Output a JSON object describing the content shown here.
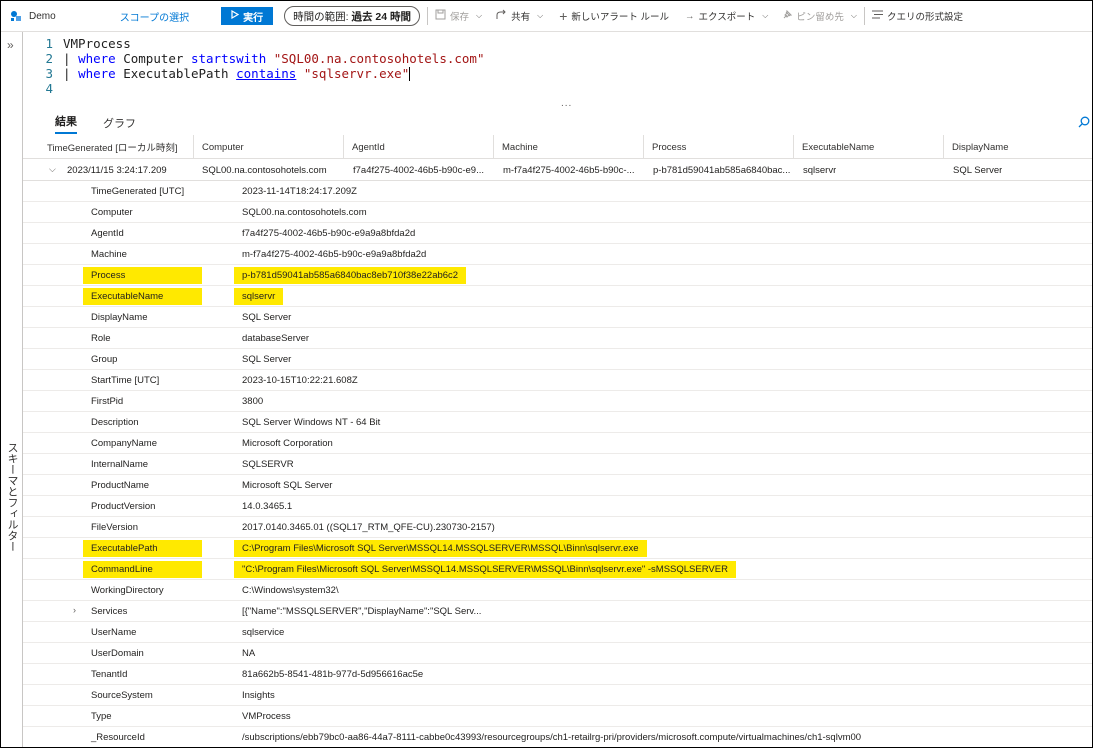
{
  "toolbar": {
    "workspace": "Demo",
    "scope_link": "スコープの選択",
    "run_label": "実行",
    "time_range_label": "時間の範囲:",
    "time_range_value": "過去 24 時間",
    "save_label": "保存",
    "share_label": "共有",
    "new_alert_label": "新しいアラート ルール",
    "export_label": "エクスポート",
    "pin_label": "ピン留め先",
    "format_label": "クエリの形式設定"
  },
  "sidebar": {
    "label": "スキーマとフィルター"
  },
  "editor": {
    "lines": [
      {
        "num": "1",
        "table": "VMProcess"
      },
      {
        "num": "2",
        "pipe": "| ",
        "kw": "where",
        "field": " Computer ",
        "op": "startswith",
        "str": " \"SQL00.na.contosohotels.com\""
      },
      {
        "num": "3",
        "pipe": "| ",
        "kw": "where",
        "field": " ExecutablePath ",
        "op": "contains",
        "str": " \"sqlservr.exe\""
      },
      {
        "num": "4"
      }
    ],
    "splitter": "..."
  },
  "tabs": [
    {
      "label": "結果",
      "active": true
    },
    {
      "label": "グラフ",
      "active": false
    }
  ],
  "grid": {
    "columns": [
      "TimeGenerated [ローカル時刻]",
      "Computer",
      "AgentId",
      "Machine",
      "Process",
      "ExecutableName",
      "DisplayName"
    ],
    "row": [
      "2023/11/15 3:24:17.209",
      "SQL00.na.contosohotels.com",
      "f7a4f275-4002-46b5-b90c-e9...",
      "m-f7a4f275-4002-46b5-b90c-...",
      "p-b781d59041ab585a6840bac...",
      "sqlservr",
      "SQL Server"
    ],
    "details": [
      {
        "key": "TimeGenerated [UTC]",
        "value": "2023-11-14T18:24:17.209Z"
      },
      {
        "key": "Computer",
        "value": "SQL00.na.contosohotels.com"
      },
      {
        "key": "AgentId",
        "value": "f7a4f275-4002-46b5-b90c-e9a9a8bfda2d"
      },
      {
        "key": "Machine",
        "value": "m-f7a4f275-4002-46b5-b90c-e9a9a8bfda2d"
      },
      {
        "key": "Process",
        "value": "p-b781d59041ab585a6840bac8eb710f38e22ab6c2",
        "highlight": true
      },
      {
        "key": "ExecutableName",
        "value": "sqlservr",
        "highlight": true
      },
      {
        "key": "DisplayName",
        "value": "SQL Server"
      },
      {
        "key": "Role",
        "value": "databaseServer"
      },
      {
        "key": "Group",
        "value": "SQL Server"
      },
      {
        "key": "StartTime [UTC]",
        "value": "2023-10-15T10:22:21.608Z"
      },
      {
        "key": "FirstPid",
        "value": "3800"
      },
      {
        "key": "Description",
        "value": "SQL Server Windows NT - 64 Bit"
      },
      {
        "key": "CompanyName",
        "value": "Microsoft Corporation"
      },
      {
        "key": "InternalName",
        "value": "SQLSERVR"
      },
      {
        "key": "ProductName",
        "value": "Microsoft SQL Server"
      },
      {
        "key": "ProductVersion",
        "value": "14.0.3465.1"
      },
      {
        "key": "FileVersion",
        "value": "2017.0140.3465.01 ((SQL17_RTM_QFE-CU).230730-2157)"
      },
      {
        "key": "ExecutablePath",
        "value": "C:\\Program Files\\Microsoft SQL Server\\MSSQL14.MSSQLSERVER\\MSSQL\\Binn\\sqlservr.exe",
        "highlight": true
      },
      {
        "key": "CommandLine",
        "value": "\"C:\\Program Files\\Microsoft SQL Server\\MSSQL14.MSSQLSERVER\\MSSQL\\Binn\\sqlservr.exe\" -sMSSQLSERVER",
        "highlight": true
      },
      {
        "key": "WorkingDirectory",
        "value": "C:\\Windows\\system32\\"
      },
      {
        "key": "Services",
        "value": "[{\"Name\":\"MSSQLSERVER\",\"DisplayName\":\"SQL Serv...",
        "expandable": true
      },
      {
        "key": "UserName",
        "value": "sqlservice"
      },
      {
        "key": "UserDomain",
        "value": "NA"
      },
      {
        "key": "TenantId",
        "value": "81a662b5-8541-481b-977d-5d956616ac5e"
      },
      {
        "key": "SourceSystem",
        "value": "Insights"
      },
      {
        "key": "Type",
        "value": "VMProcess"
      },
      {
        "key": "_ResourceId",
        "value": "/subscriptions/ebb79bc0-aa86-44a7-8111-cabbe0c43993/resourcegroups/ch1-retailrg-pri/providers/microsoft.compute/virtualmachines/ch1-sqlvm00"
      }
    ]
  },
  "colors": {
    "accent": "#0078d4",
    "highlight": "#ffe900"
  },
  "icons": [
    "log-analytics-icon",
    "play-icon",
    "save-icon",
    "share-icon",
    "plus-icon",
    "arrow-right-icon",
    "pin-icon",
    "format-icon",
    "double-chevron-icon",
    "search-icon",
    "chevron-down-icon",
    "chevron-right-icon"
  ]
}
